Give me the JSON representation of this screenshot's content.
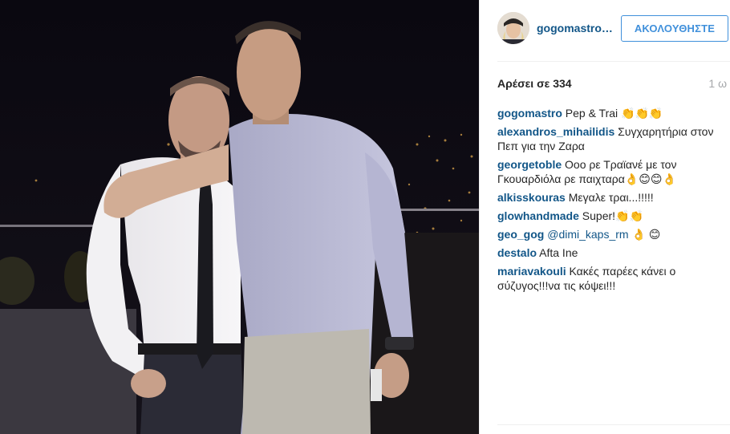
{
  "post": {
    "author": "gogomastro…",
    "follow_label": "ΑΚΟΛΟΥΘΗΣΤΕ",
    "likes_label": "Αρέσει σε 334",
    "timestamp": "1 ω"
  },
  "comments": [
    {
      "user": "gogomastro",
      "text": " Pep & Trai 👏👏👏"
    },
    {
      "user": "alexandros_mihailidis",
      "text": " Συγχαρητήρια στον Πεπ για την Ζαρα"
    },
    {
      "user": "georgetoble",
      "text": " Οοο ρε Τραϊανέ με τον Γκουαρδιόλα ρε παιχταρα👌😊😊👌"
    },
    {
      "user": "alkisskouras",
      "text": " Μεγαλε τραι...!!!!!"
    },
    {
      "user": "glowhandmade",
      "text": " Super!👏👏"
    },
    {
      "user": "geo_gog",
      "mention": " @dimi_kaps_rm",
      "text": " 👌 😊"
    },
    {
      "user": "destalo",
      "text": " Afta Ine"
    },
    {
      "user": "mariavakouli",
      "text": " Κακές παρέες κάνει ο σύζυγος!!!να τις κόψει!!!"
    }
  ],
  "colors": {
    "link": "#125688",
    "follow": "#4090db",
    "muted": "#a5a7aa"
  },
  "icons": {
    "avatar": "avatar-image",
    "photo": "post-photo"
  }
}
